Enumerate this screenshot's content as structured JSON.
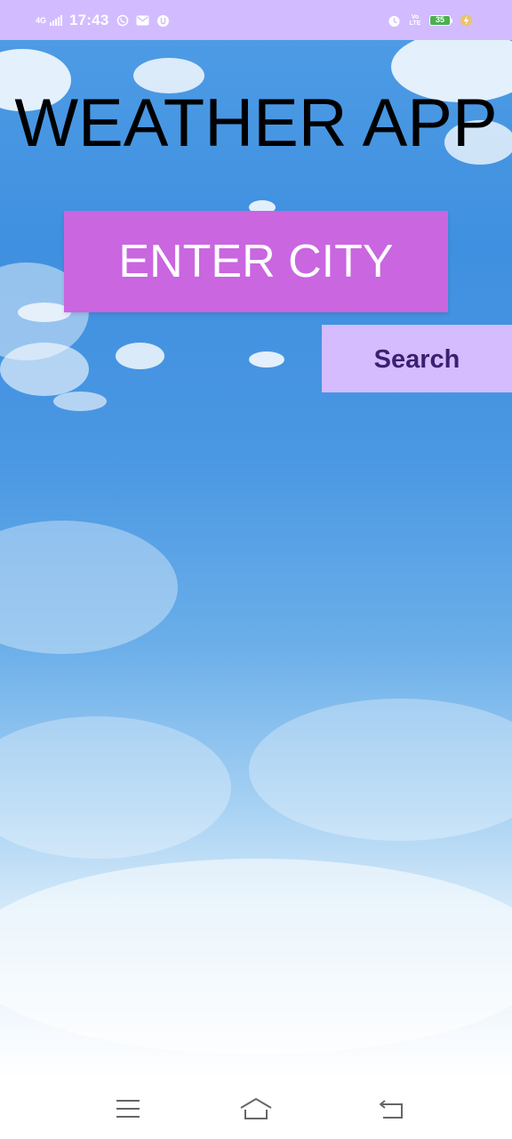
{
  "status_bar": {
    "network_type": "4G",
    "time": "17:43",
    "volte": "Vo LTE",
    "battery": "35",
    "icons": [
      "signal-icon",
      "whatsapp-icon",
      "mail-icon",
      "app-notification-icon",
      "alarm-icon",
      "volte-icon",
      "battery-icon",
      "charging-icon"
    ]
  },
  "app": {
    "title": "WEATHER APP",
    "city_input": {
      "placeholder": "ENTER CITY",
      "value": ""
    },
    "search_label": "Search"
  },
  "nav_bar": {
    "icons": [
      "menu-icon",
      "home-icon",
      "back-icon"
    ]
  },
  "colors": {
    "status_bar": "#d2bcff",
    "input_background": "#c966e0",
    "search_background": "#d4bcff",
    "search_text": "#3b1f72",
    "sky": "#4d9be5"
  }
}
